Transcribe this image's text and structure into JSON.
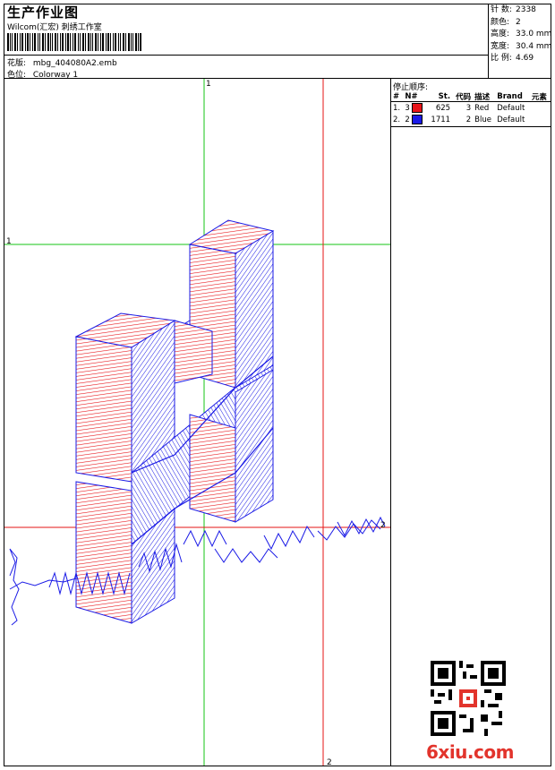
{
  "header": {
    "title": "生产作业图",
    "subtitle": "Wilcom(汇宏) 刺绣工作室",
    "design_label": "花版:",
    "design_value": "mbg_404080A2.emb",
    "colorway_label": "色位:",
    "colorway_value": "Colorway 1"
  },
  "stats": [
    {
      "label": "针 数:",
      "value": "2338"
    },
    {
      "label": "颜色:",
      "value": "2"
    },
    {
      "label": "高度:",
      "value": "33.0 mm"
    },
    {
      "label": "宽度:",
      "value": "30.4 mm"
    },
    {
      "label": "比 例:",
      "value": "4.69"
    }
  ],
  "stop_sequence": {
    "title": "停止顺序:",
    "columns": [
      "#",
      "N#",
      "St.",
      "代码",
      "描述",
      "Brand",
      "元素"
    ],
    "rows": [
      {
        "num": "1.",
        "needle": "3",
        "color": "#e8141a",
        "stitches": "625",
        "code": "3",
        "desc": "Red",
        "brand": "Default"
      },
      {
        "num": "2.",
        "needle": "2",
        "color": "#1a1ae6",
        "stitches": "1711",
        "code": "2",
        "desc": "Blue",
        "brand": "Default"
      }
    ]
  },
  "axes": {
    "top_label": "1",
    "left_label": "1",
    "right_label": "2",
    "bottom_label": "2"
  },
  "colors": {
    "red_thread": "#e8141a",
    "blue_thread": "#1a1ae6",
    "guide_green": "#16c616",
    "guide_red": "#e61616",
    "watermark": "#e2342c"
  },
  "watermark": "6xiu.com",
  "qr_icon": "qr-code-icon"
}
